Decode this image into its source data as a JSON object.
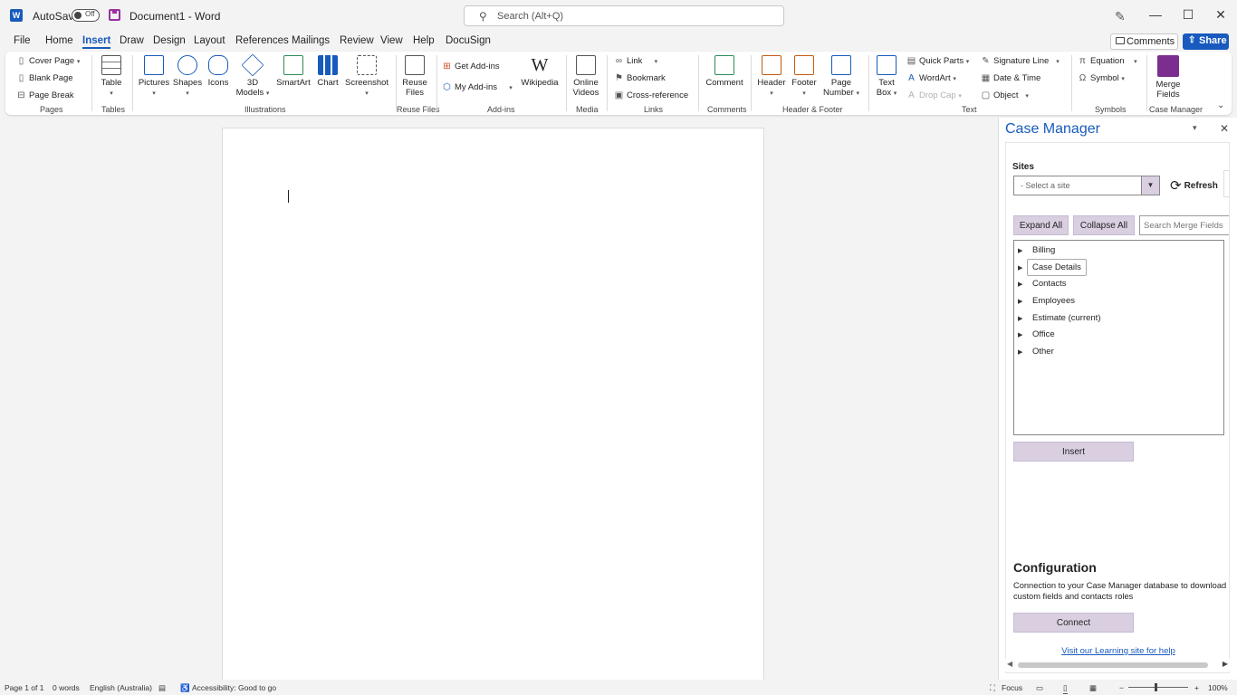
{
  "titlebar": {
    "app_logo": "W",
    "autosave_label": "AutoSave",
    "autosave_state": "Off",
    "doc_title": "Document1  -  Word",
    "search_placeholder": "Search (Alt+Q)",
    "minimize": "—",
    "maximize": "☐",
    "close": "✕"
  },
  "menu": {
    "tabs": [
      "File",
      "Home",
      "Insert",
      "Draw",
      "Design",
      "Layout",
      "References",
      "Mailings",
      "Review",
      "View",
      "Help",
      "DocuSign"
    ],
    "active_tab": "Insert",
    "comments_label": "Comments",
    "share_label": "Share"
  },
  "ribbon": {
    "pages": {
      "cover_page": "Cover Page",
      "blank_page": "Blank Page",
      "page_break": "Page Break",
      "label": "Pages"
    },
    "tables": {
      "table": "Table",
      "label": "Tables"
    },
    "illustrations": {
      "pictures": "Pictures",
      "shapes": "Shapes",
      "icons": "Icons",
      "models_3d_line1": "3D",
      "models_3d_line2": "Models",
      "smartart": "SmartArt",
      "chart": "Chart",
      "screenshot": "Screenshot",
      "label": "Illustrations"
    },
    "reuse": {
      "reuse_line1": "Reuse",
      "reuse_line2": "Files",
      "label": "Reuse Files"
    },
    "addins": {
      "get_addins": "Get Add-ins",
      "my_addins": "My Add-ins",
      "wikipedia": "Wikipedia",
      "label": "Add-ins"
    },
    "media": {
      "online_line1": "Online",
      "online_line2": "Videos",
      "label": "Media"
    },
    "links": {
      "link": "Link",
      "bookmark": "Bookmark",
      "cross_reference": "Cross-reference",
      "label": "Links"
    },
    "comments": {
      "comment": "Comment",
      "label": "Comments"
    },
    "header_footer": {
      "header": "Header",
      "footer": "Footer",
      "page_number_line1": "Page",
      "page_number_line2": "Number",
      "label": "Header & Footer"
    },
    "text": {
      "textbox_line1": "Text",
      "textbox_line2": "Box",
      "quick_parts": "Quick Parts",
      "wordart": "WordArt",
      "drop_cap": "Drop Cap",
      "signature_line": "Signature Line",
      "date_time": "Date & Time",
      "object": "Object",
      "label": "Text"
    },
    "symbols": {
      "equation": "Equation",
      "symbol": "Symbol",
      "label": "Symbols"
    },
    "case_manager": {
      "merge_line1": "Merge",
      "merge_line2": "Fields",
      "label": "Case Manager"
    }
  },
  "pane": {
    "title": "Case Manager",
    "sites_label": "Sites",
    "site_placeholder": "- Select  a site",
    "refresh_label": "Refresh",
    "expand_all": "Expand All",
    "collapse_all": "Collapse All",
    "search_placeholder": "Search Merge Fields",
    "tree_items": [
      "Billing",
      "Case Details",
      "Contacts",
      "Employees",
      "Estimate (current)",
      "Office",
      "Other"
    ],
    "selected_item": "Case Details",
    "insert_label": "Insert",
    "config_title": "Configuration",
    "config_text": "Connection to your Case Manager database to download custom fields and contacts roles",
    "connect_label": "Connect",
    "learning_link": "Visit our Learning site for help"
  },
  "statusbar": {
    "page": "Page 1 of 1",
    "words": "0 words",
    "language": "English (Australia)",
    "accessibility": "Accessibility: Good to go",
    "focus": "Focus",
    "zoom_minus": "−",
    "zoom_plus": "+",
    "zoom_level": "100%"
  },
  "colors": {
    "accent": "#185abd",
    "pane_button": "#d9cfe1",
    "save_icon": "#9b2fa3"
  }
}
